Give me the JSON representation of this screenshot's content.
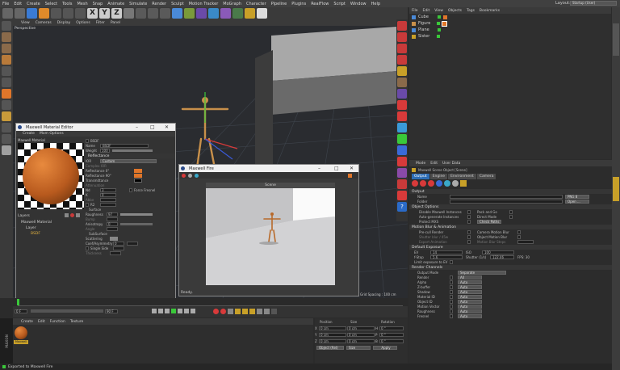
{
  "menu": [
    "File",
    "Edit",
    "Create",
    "Select",
    "Tools",
    "Mesh",
    "Snap",
    "Animate",
    "Simulate",
    "Render",
    "Sculpt",
    "Motion Tracker",
    "MoGraph",
    "Character",
    "Pipeline",
    "Plugins",
    "RealFlow",
    "Script",
    "Window",
    "Help"
  ],
  "layout": {
    "label": "Layout:",
    "value": "Startup (User)"
  },
  "toolbar_letters": [
    "X",
    "Y",
    "Z"
  ],
  "viewport": {
    "menu": [
      "View",
      "Cameras",
      "Display",
      "Options",
      "Filter",
      "Panel"
    ],
    "label": "Perspective",
    "grid_spacing": "Grid Spacing : 100 cm"
  },
  "objmgr": {
    "menu": [
      "File",
      "Edit",
      "View",
      "Objects",
      "Tags",
      "Bookmarks"
    ],
    "objects": [
      "Cube",
      "Figure",
      "Plane",
      "Sister"
    ]
  },
  "mat_editor": {
    "title": "Maxwell Material Editor",
    "menu": [
      "Create",
      "Mxm Options"
    ],
    "mat_label": "Maxwell Material",
    "bsdf": "BSDF",
    "name_label": "Name",
    "name_value": "BSDF",
    "weight_label": "Weight",
    "weight_value": "100",
    "reflectance": "Reflectance",
    "ior_label": "IOR",
    "ior_value": "Custom",
    "complex_ior": "Complex IOR",
    "refl0": "Reflectance 0°",
    "refl90": "Reflectance 90°",
    "transmittance": "Transmittance",
    "attenuation": "Attenuation",
    "nd_label": "Nd",
    "nd_value": "3",
    "force_fresnel": "Force Fresnel",
    "k_label": "K",
    "k_value": "0",
    "abbe": "Abbe",
    "r2": "R2",
    "surface": "Surface",
    "roughness": "Roughness",
    "roughness_value": "97",
    "bump": "Bump",
    "anisotropy": "Anisotropy",
    "anisotropy_value": "0",
    "angle": "Angle",
    "subsurface": "SubSurface",
    "scattering": "Scattering",
    "coef_asym": "Coef/Asymmetry",
    "coef_value": "0",
    "single_side": "Single Side",
    "thickness": "Thickness",
    "layers": "Layers",
    "tree": [
      "Maxwell Material",
      "Layer",
      "BSDF"
    ]
  },
  "maxwell_fire": {
    "title": "Maxwell Fire",
    "scene": "Scene",
    "status": "Ready."
  },
  "attr": {
    "menu": [
      "Mode",
      "Edit",
      "User Data"
    ],
    "title": "Maxwell Scene Object [Scene]",
    "tabs": [
      "Output",
      "Engine",
      "Environment",
      "Camera"
    ],
    "output": "Output",
    "name_label": "Name",
    "format": "PNG 8",
    "folder_label": "Folder",
    "open": "Open ...",
    "object_options": "Object Options",
    "disable_inst": "Disable Maxwell Instances",
    "pack_go": "Pack and Go",
    "auto_inst": "Auto-generate Instances",
    "direct_mode": "Direct Mode",
    "protect_mxs": "Protect MXS",
    "check_paths": "Check Paths",
    "mblur": "Motion Blur & Animation",
    "pre_cull": "Pre-cull Render",
    "camera_mblur": "Camera Motion Blur",
    "shutter_blur": "Shutter blur / 45w",
    "object_mblur": "Object Motion Blur",
    "export_anim": "Export Animation",
    "mblur_steps": "Motion Blur Steps",
    "default_exposure": "Default Exposure",
    "ev_label": "EV",
    "ev_value": "14",
    "iso_label": "ISO",
    "iso_value": "100",
    "fstop_label": "f-Stop",
    "fstop_value": "5.6",
    "shutter_label": "Shutter (1/s)",
    "shutter_value": "122.46",
    "fps": "FPS: 30",
    "limit_exposure": "Limit exposure to EV",
    "render_channels": "Render Channels",
    "output_mode": "Output Mode",
    "output_mode_value": "Separate",
    "channels": [
      "Render",
      "Alpha",
      "Z-buffer",
      "Shadow",
      "Material ID",
      "Object ID",
      "Motion Vector",
      "Roughness",
      "Fresnel"
    ],
    "channel_values": [
      "All",
      "Auto",
      "Auto",
      "Auto",
      "Auto",
      "Auto",
      "Auto",
      "Auto",
      "Auto"
    ]
  },
  "timeline": {
    "start": "0 F",
    "end": "90 F",
    "frame": "0 F"
  },
  "matmgr": {
    "menu": [
      "Create",
      "Edit",
      "Function",
      "Texture"
    ],
    "mat": "Maxwell"
  },
  "coords": {
    "headers": [
      "Position",
      "Size",
      "Rotation"
    ],
    "rows": [
      [
        "X",
        "0 cm",
        "0 cm",
        "H",
        "0 °"
      ],
      [
        "Y",
        "0 cm",
        "0 cm",
        "P",
        "0 °"
      ],
      [
        "Z",
        "0 cm",
        "0 cm",
        "B",
        "0 °"
      ]
    ],
    "obj_sel": "Object (Rel)",
    "size_sel": "Size",
    "apply": "Apply"
  },
  "status": {
    "text": "Exported to Maxwell Fire"
  },
  "colors": {
    "accent": "#2d6db5",
    "orange": "#e0762a",
    "bg": "#2b2b2b"
  }
}
